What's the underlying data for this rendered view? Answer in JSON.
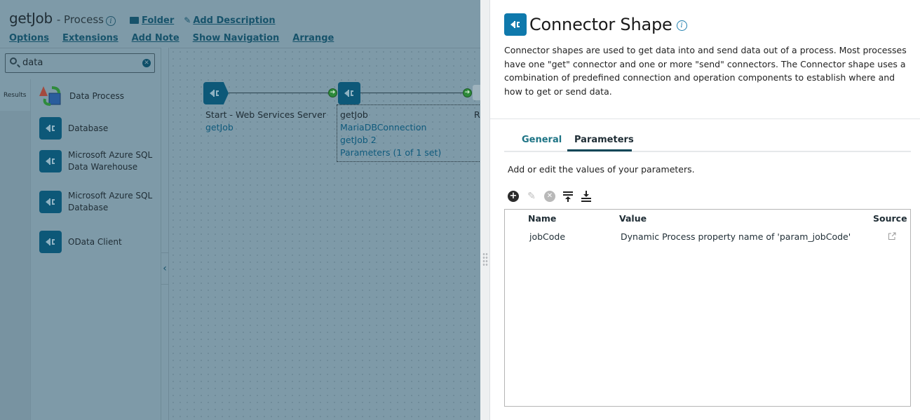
{
  "app": {
    "title": "getJob",
    "subtitle": "- Process",
    "info_icon": "info-icon",
    "folder_link": "Folder",
    "add_description_link": "Add Description",
    "menu": [
      "Options",
      "Extensions",
      "Add Note",
      "Show Navigation",
      "Arrange"
    ]
  },
  "palette": {
    "search": {
      "value": "data",
      "placeholder": ""
    },
    "results_label": "Results",
    "items": [
      {
        "label_lines": [
          "Data Process"
        ],
        "icon": "data-process-icon"
      },
      {
        "label_lines": [
          "Database"
        ],
        "icon": "connector-icon"
      },
      {
        "label_lines": [
          "Microsoft Azure SQL",
          "Data Warehouse"
        ],
        "icon": "connector-icon"
      },
      {
        "label_lines": [
          "Microsoft Azure SQL",
          "Database"
        ],
        "icon": "connector-icon"
      },
      {
        "label_lines": [
          "OData Client"
        ],
        "icon": "connector-icon"
      }
    ]
  },
  "canvas": {
    "nodes": [
      {
        "title": "Start - Web Services Server",
        "links": [
          "getJob"
        ]
      },
      {
        "title": "getJob",
        "links": [
          "MariaDBConnection",
          "getJob 2",
          "Parameters (1 of 1 set)"
        ]
      },
      {
        "title": "R",
        "links": []
      }
    ],
    "collapse_icon": "‹"
  },
  "panel": {
    "title": "Connector Shape",
    "description": "Connector shapes are used to get data into and send data out of a process. Most processes have one \"get\" connector and one or more \"send\" connectors. The Connector shape uses a combination of predefined connection and operation components to establish where and how to get or send data.",
    "tabs": [
      {
        "label": "General",
        "active": false
      },
      {
        "label": "Parameters",
        "active": true
      }
    ],
    "help_text": "Add or edit the values of your parameters.",
    "toolbar": [
      "add-icon",
      "edit-icon",
      "delete-icon",
      "move-top-icon",
      "move-bottom-icon"
    ],
    "grid": {
      "columns": [
        "Name",
        "Value",
        "Source"
      ],
      "rows": [
        {
          "name": "jobCode",
          "value": "Dynamic Process property name of 'param_jobCode'",
          "source_icon": "external-link-icon"
        }
      ]
    }
  }
}
